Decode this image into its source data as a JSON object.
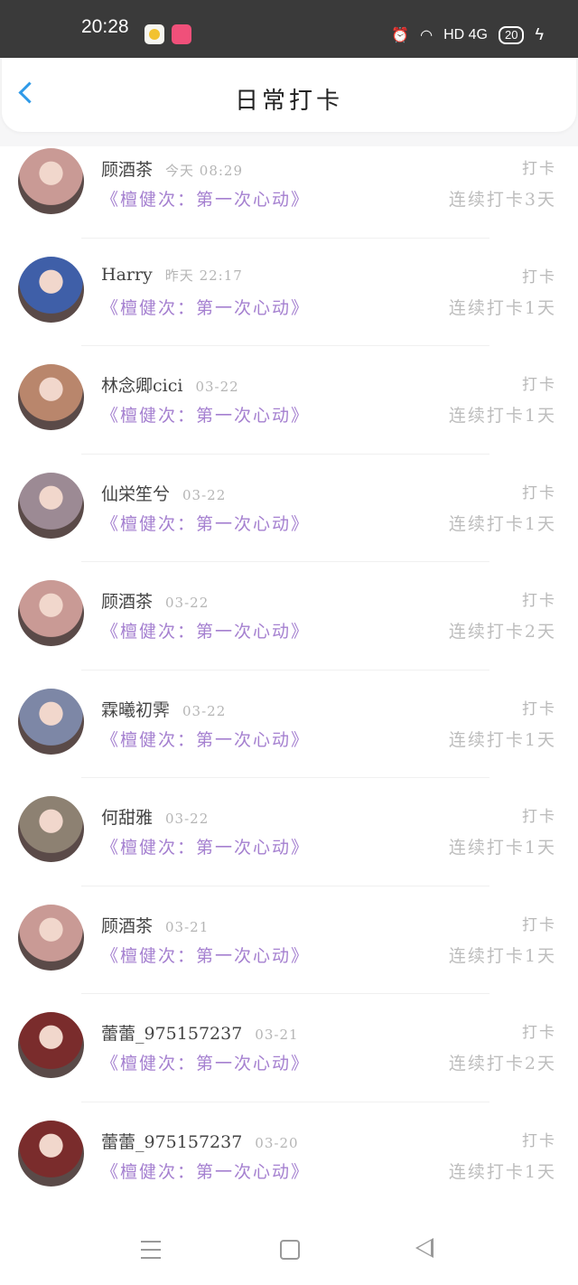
{
  "status_bar": {
    "time": "20:28",
    "network": "HD 4G",
    "battery": "20"
  },
  "header": {
    "title": "日常打卡"
  },
  "checkins": [
    {
      "name": "顾酒茶",
      "date": "今天 08:29",
      "label": "打卡",
      "topic": "《檀健次：第一次心动》",
      "streak": "连续打卡3天",
      "avatar_color": "#c99a95"
    },
    {
      "name": "Harry",
      "date": "昨天 22:17",
      "label": "打卡",
      "topic": "《檀健次：第一次心动》",
      "streak": "连续打卡1天",
      "avatar_color": "#3f5fa8"
    },
    {
      "name": "林念卿cici",
      "date": "03-22",
      "label": "打卡",
      "topic": "《檀健次：第一次心动》",
      "streak": "连续打卡1天",
      "avatar_color": "#b9866c"
    },
    {
      "name": "仙栄笙兮",
      "date": "03-22",
      "label": "打卡",
      "topic": "《檀健次：第一次心动》",
      "streak": "连续打卡1天",
      "avatar_color": "#9c8a94"
    },
    {
      "name": "顾酒茶",
      "date": "03-22",
      "label": "打卡",
      "topic": "《檀健次：第一次心动》",
      "streak": "连续打卡2天",
      "avatar_color": "#c99a95"
    },
    {
      "name": "霖曦初霁",
      "date": "03-22",
      "label": "打卡",
      "topic": "《檀健次：第一次心动》",
      "streak": "连续打卡1天",
      "avatar_color": "#7d87a6"
    },
    {
      "name": "何甜雅",
      "date": "03-22",
      "label": "打卡",
      "topic": "《檀健次：第一次心动》",
      "streak": "连续打卡1天",
      "avatar_color": "#8d8172"
    },
    {
      "name": "顾酒茶",
      "date": "03-21",
      "label": "打卡",
      "topic": "《檀健次：第一次心动》",
      "streak": "连续打卡1天",
      "avatar_color": "#c99a95"
    },
    {
      "name": "蕾蕾_975157237",
      "date": "03-21",
      "label": "打卡",
      "topic": "《檀健次：第一次心动》",
      "streak": "连续打卡2天",
      "avatar_color": "#7a2c2c"
    },
    {
      "name": "蕾蕾_975157237",
      "date": "03-20",
      "label": "打卡",
      "topic": "《檀健次：第一次心动》",
      "streak": "连续打卡1天",
      "avatar_color": "#7a2c2c"
    }
  ],
  "colors": {
    "accent": "#2f9ae8",
    "topic_link": "#a580d0",
    "muted": "#bdbdbd"
  }
}
